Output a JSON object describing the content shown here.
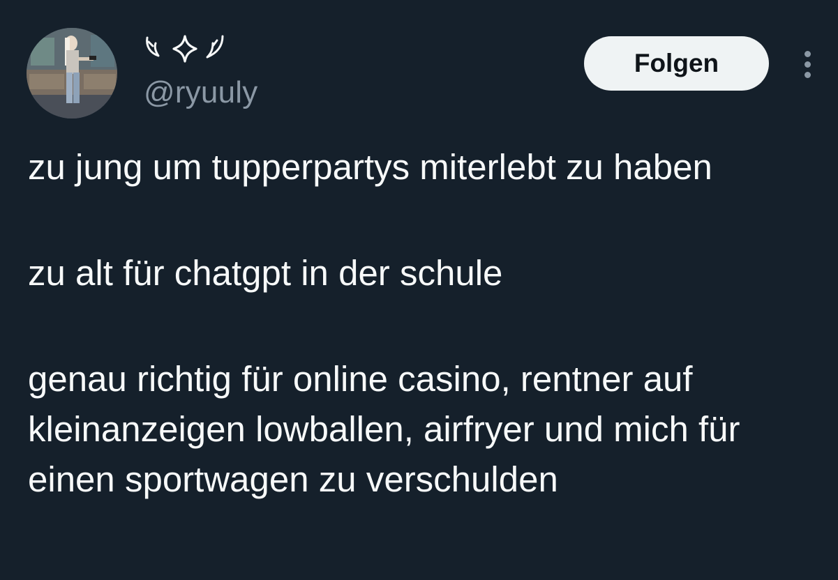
{
  "author": {
    "display_name_icons": [
      "left-wing-icon",
      "sparkle-icon",
      "right-wing-icon"
    ],
    "handle": "@ryuuly"
  },
  "actions": {
    "follow_label": "Folgen",
    "more_icon": "more-vertical-icon"
  },
  "tweet": {
    "paragraphs": [
      "zu jung um tupperpartys miterlebt zu haben",
      "zu alt für chatgpt in der schule",
      "genau richtig für online casino, rentner auf kleinanzeigen lowballen, airfryer und mich für einen sportwagen zu verschulden"
    ]
  },
  "colors": {
    "background": "#15202b",
    "text_primary": "#f7f9f9",
    "text_secondary": "#8b98a5",
    "button_bg": "#eff3f4",
    "button_text": "#0f1419"
  }
}
